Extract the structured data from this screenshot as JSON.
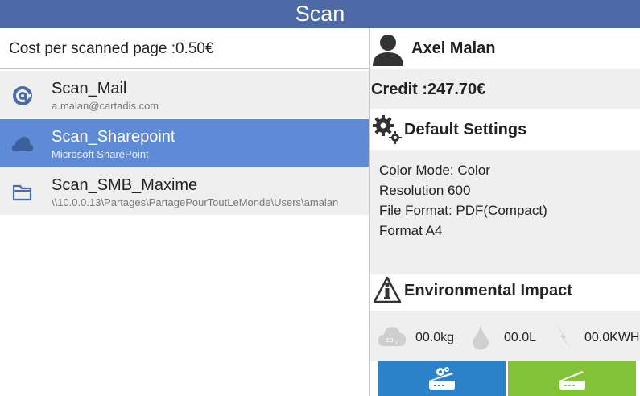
{
  "window": {
    "title": "Scan"
  },
  "left": {
    "cost_label": "Cost per scanned page :0.50€",
    "destinations": [
      {
        "name": "Scan_Mail",
        "detail": "a.malan@cartadis.com",
        "icon": "at-icon",
        "selected": false
      },
      {
        "name": "Scan_Sharepoint",
        "detail": "Microsoft SharePoint",
        "icon": "cloud-icon",
        "selected": true
      },
      {
        "name": "Scan_SMB_Maxime",
        "detail": "\\\\10.0.0.13\\Partages\\PartagePourToutLeMonde\\Users\\amalan",
        "icon": "folder-icon",
        "selected": false
      }
    ]
  },
  "user": {
    "name": "Axel Malan",
    "credit": "Credit :247.70€"
  },
  "settings": {
    "title": "Default Settings",
    "color_mode": "Color Mode: Color",
    "resolution": "Resolution 600",
    "file_format": "File Format: PDF(Compact)",
    "format": "Format A4"
  },
  "environment": {
    "title": "Environmental Impact",
    "co2": "00.0kg",
    "water": "00.0L",
    "energy": "00.0KWH"
  },
  "buttons": {
    "settings_icon": "scanner-settings-icon",
    "scan_icon": "scanner-icon"
  },
  "colors": {
    "titlebar": "#4d6aa6",
    "selected": "#5e8ad6",
    "blue_button": "#2b82c9",
    "green_button": "#82c236"
  }
}
